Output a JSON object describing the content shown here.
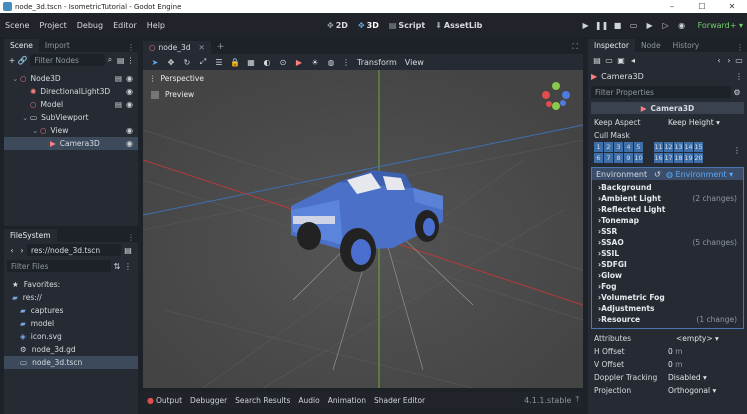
{
  "window": {
    "title": "node_3d.tscn - IsometricTutorial - Godot Engine"
  },
  "menu": [
    "Scene",
    "Project",
    "Debug",
    "Editor",
    "Help"
  ],
  "modes": [
    {
      "label": "2D",
      "icon": "2d-icon"
    },
    {
      "label": "3D",
      "icon": "3d-icon"
    },
    {
      "label": "Script",
      "icon": "script-icon"
    },
    {
      "label": "AssetLib",
      "icon": "assetlib-icon"
    }
  ],
  "renderer": "Forward+",
  "scene_dock": {
    "tabs": [
      "Scene",
      "Import"
    ],
    "filter_placeholder": "Filter Nodes",
    "nodes": [
      {
        "label": "Node3D",
        "depth": 0,
        "color": "#fc7f7f"
      },
      {
        "label": "DirectionalLight3D",
        "depth": 1,
        "color": "#fc7f7f"
      },
      {
        "label": "Model",
        "depth": 1,
        "color": "#fc7f7f"
      },
      {
        "label": "SubViewport",
        "depth": 1,
        "color": "#e0e0e0"
      },
      {
        "label": "View",
        "depth": 2,
        "color": "#fc7f7f"
      },
      {
        "label": "Camera3D",
        "depth": 3,
        "color": "#fc7f7f"
      }
    ]
  },
  "filesystem": {
    "tab": "FileSystem",
    "path": "res://node_3d.tscn",
    "filter_placeholder": "Filter Files",
    "items": [
      {
        "label": "Favorites:",
        "depth": 0,
        "icon": "star-icon"
      },
      {
        "label": "res://",
        "depth": 0,
        "icon": "folder-icon"
      },
      {
        "label": "captures",
        "depth": 1,
        "icon": "folder-icon"
      },
      {
        "label": "model",
        "depth": 1,
        "icon": "folder-icon"
      },
      {
        "label": "icon.svg",
        "depth": 1,
        "icon": "image-icon"
      },
      {
        "label": "node_3d.gd",
        "depth": 1,
        "icon": "script-icon"
      },
      {
        "label": "node_3d.tscn",
        "depth": 1,
        "icon": "scene-icon"
      }
    ]
  },
  "editor_tab": "node_3d",
  "viewport": {
    "menus": [
      "Transform",
      "View"
    ],
    "perspective": "Perspective",
    "preview": "Preview"
  },
  "bottom": {
    "tabs": [
      "Output",
      "Debugger",
      "Search Results",
      "Audio",
      "Animation",
      "Shader Editor"
    ],
    "version": "4.1.1.stable"
  },
  "inspector": {
    "tabs": [
      "Inspector",
      "Node",
      "History"
    ],
    "node": "Camera3D",
    "filter_placeholder": "Filter Properties",
    "class": "Camera3D",
    "keep_aspect_label": "Keep Aspect",
    "keep_aspect": "Keep Height",
    "cull_mask_label": "Cull Mask",
    "cull_row1": [
      "1",
      "2",
      "3",
      "4",
      "5",
      "",
      "11",
      "12",
      "13",
      "14",
      "15"
    ],
    "cull_row2": [
      "6",
      "7",
      "8",
      "9",
      "10",
      "",
      "16",
      "17",
      "18",
      "19",
      "20"
    ],
    "environment_label": "Environment",
    "environment_value": "Environment",
    "sections": [
      {
        "label": "Background",
        "changes": ""
      },
      {
        "label": "Ambient Light",
        "changes": "(2 changes)"
      },
      {
        "label": "Reflected Light",
        "changes": ""
      },
      {
        "label": "Tonemap",
        "changes": ""
      },
      {
        "label": "SSR",
        "changes": ""
      },
      {
        "label": "SSAO",
        "changes": "(5 changes)"
      },
      {
        "label": "SSIL",
        "changes": ""
      },
      {
        "label": "SDFGI",
        "changes": ""
      },
      {
        "label": "Glow",
        "changes": ""
      },
      {
        "label": "Fog",
        "changes": ""
      },
      {
        "label": "Volumetric Fog",
        "changes": ""
      },
      {
        "label": "Adjustments",
        "changes": ""
      },
      {
        "label": "Resource",
        "changes": "(1 change)"
      }
    ],
    "attributes_label": "Attributes",
    "attributes_value": "<empty>",
    "h_offset_label": "H Offset",
    "h_offset": "0",
    "v_offset_label": "V Offset",
    "v_offset": "0",
    "unit": "m",
    "doppler_label": "Doppler Tracking",
    "doppler": "Disabled",
    "projection_label": "Projection",
    "projection": "Orthogonal"
  }
}
